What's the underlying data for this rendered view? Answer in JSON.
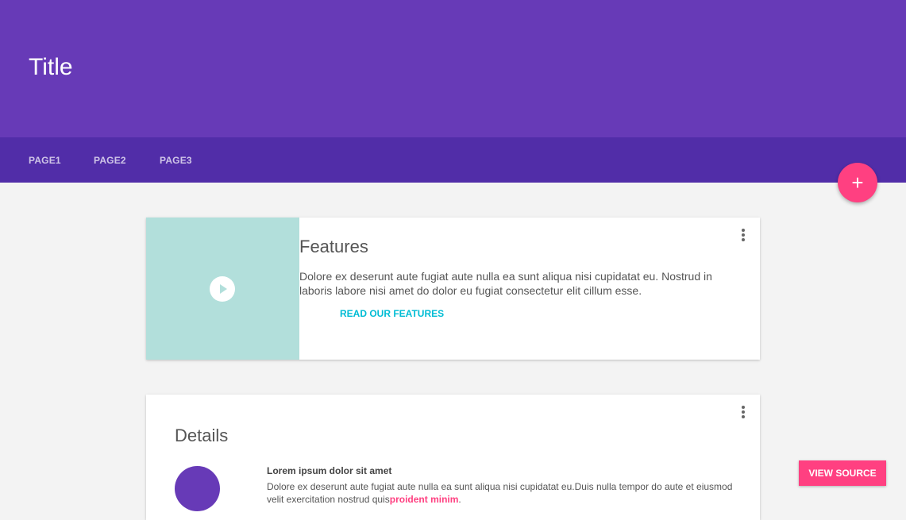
{
  "header": {
    "title": "Title",
    "tabs": [
      {
        "label": "PAGE1"
      },
      {
        "label": "PAGE2"
      },
      {
        "label": "PAGE3"
      }
    ],
    "fab_label": "+"
  },
  "cards": {
    "features": {
      "title": "Features",
      "text": "Dolore ex deserunt aute fugiat aute nulla ea sunt aliqua nisi cupidatat eu. Nostrud in laboris labore nisi amet do dolor eu fugiat consectetur elit cillum esse.",
      "action": "READ OUR FEATURES"
    },
    "details": {
      "title": "Details",
      "item_title": "Lorem ipsum dolor sit amet",
      "item_text": "Dolore ex deserunt aute fugiat aute nulla ea sunt aliqua nisi cupidatat eu.Duis nulla tempor do aute et eiusmod velit exercitation nostrud quis",
      "link": "proident minim",
      "after_link": "."
    }
  },
  "view_source": "VIEW SOURCE",
  "colors": {
    "primary": "#673ab7",
    "primary_dark": "#512da8",
    "accent": "#ff4081",
    "media": "#b2dfdb",
    "action": "#00bcd4"
  },
  "icons": [
    "play-icon",
    "more-vertical-icon",
    "plus-icon"
  ]
}
